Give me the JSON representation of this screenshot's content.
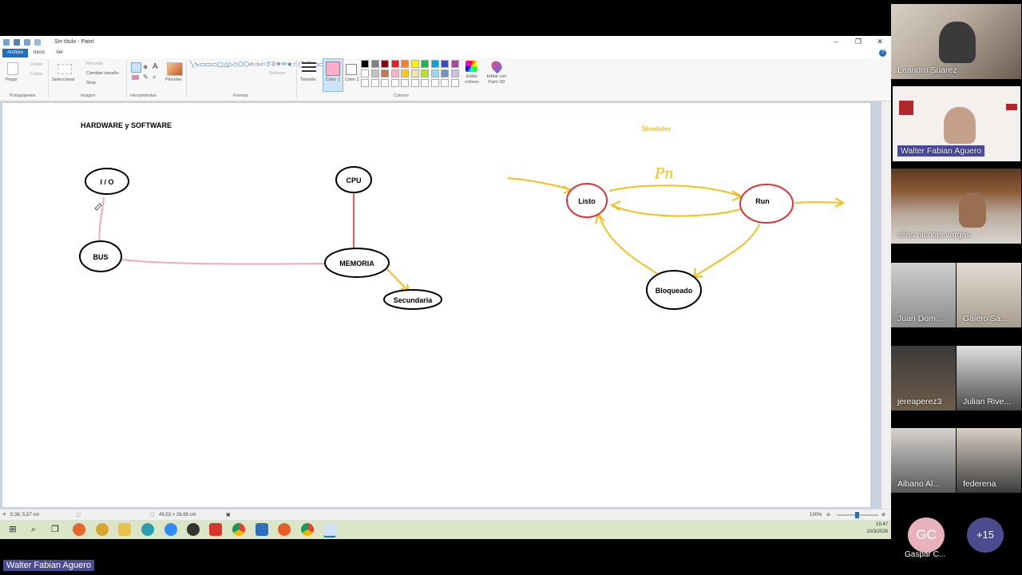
{
  "paint": {
    "window_title": "Sin título - Paint",
    "tabs": [
      "Archivo",
      "Inicio",
      "Ver"
    ],
    "ribbon": {
      "clipboard": {
        "paste": "Pegar",
        "cut": "Cortar",
        "copy": "Copiar",
        "label": "Portapapeles"
      },
      "image": {
        "select": "Seleccionar",
        "crop": "Recortar",
        "resize": "Cambiar tamaño",
        "rotate": "Girar",
        "label": "Imagen"
      },
      "tools": {
        "label": "Herramientas",
        "brushes": "Pinceles"
      },
      "shapes": {
        "outline": "Contorno",
        "fill": "Rellenar",
        "label": "Formas"
      },
      "size": "Tamaño",
      "color1": "Color 1",
      "color2": "Color 2",
      "colors_label": "Colores",
      "edit_colors": "Editar colores",
      "edit_paint3d": "Editar con Paint 3D",
      "palette_top": [
        "#000000",
        "#7f7f7f",
        "#880015",
        "#ed1c24",
        "#ff7f27",
        "#fff200",
        "#22b14c",
        "#00a2e8",
        "#3f48cc",
        "#a349a4"
      ],
      "palette_bottom": [
        "#ffffff",
        "#c3c3c3",
        "#b97a57",
        "#ffaec9",
        "#ffc90e",
        "#efe4b0",
        "#b5e61d",
        "#99d9ea",
        "#7092be",
        "#c8bfe7"
      ],
      "color1_value": "#ffaec9",
      "color2_value": "#ffffff"
    },
    "canvas": {
      "title": "HARDWARE y SOFTWARE",
      "scheduler_label": "Sheduler",
      "nodes": [
        "I / O",
        "BUS",
        "CPU",
        "MEMORIA",
        "Secundaria",
        "Listo",
        "Run",
        "Bloqueado"
      ],
      "handwritten": "Pn"
    },
    "status": {
      "cursor_pos": "5,38, 5,57 cm",
      "canvas_size": "49,53 × 26,69 cm",
      "zoom": "100%"
    },
    "taskbar": {
      "time": "16:47",
      "date": "10/3/2026"
    }
  },
  "participants": [
    {
      "name": "Leandro Suarez"
    },
    {
      "name": "Walter Fabian Aguero"
    },
    {
      "name": "elias.nicolas.vargas"
    },
    {
      "name": "Juan Dom..."
    },
    {
      "name": "Gaiero Sa..."
    },
    {
      "name": "jereaperez3"
    },
    {
      "name": "Julian Rive..."
    },
    {
      "name": "Albano Al..."
    },
    {
      "name": "federena"
    },
    {
      "name": "Gaspar C...",
      "initials": "GC"
    },
    {
      "more": "+15"
    }
  ],
  "active_speaker_label": "Walter Fabian Aguero",
  "colors": {
    "pink_line": "#f3a8c2",
    "yellow_line": "#f2c01c",
    "red_line": "#d9343b",
    "scheduler_text": "#f2c01c"
  }
}
